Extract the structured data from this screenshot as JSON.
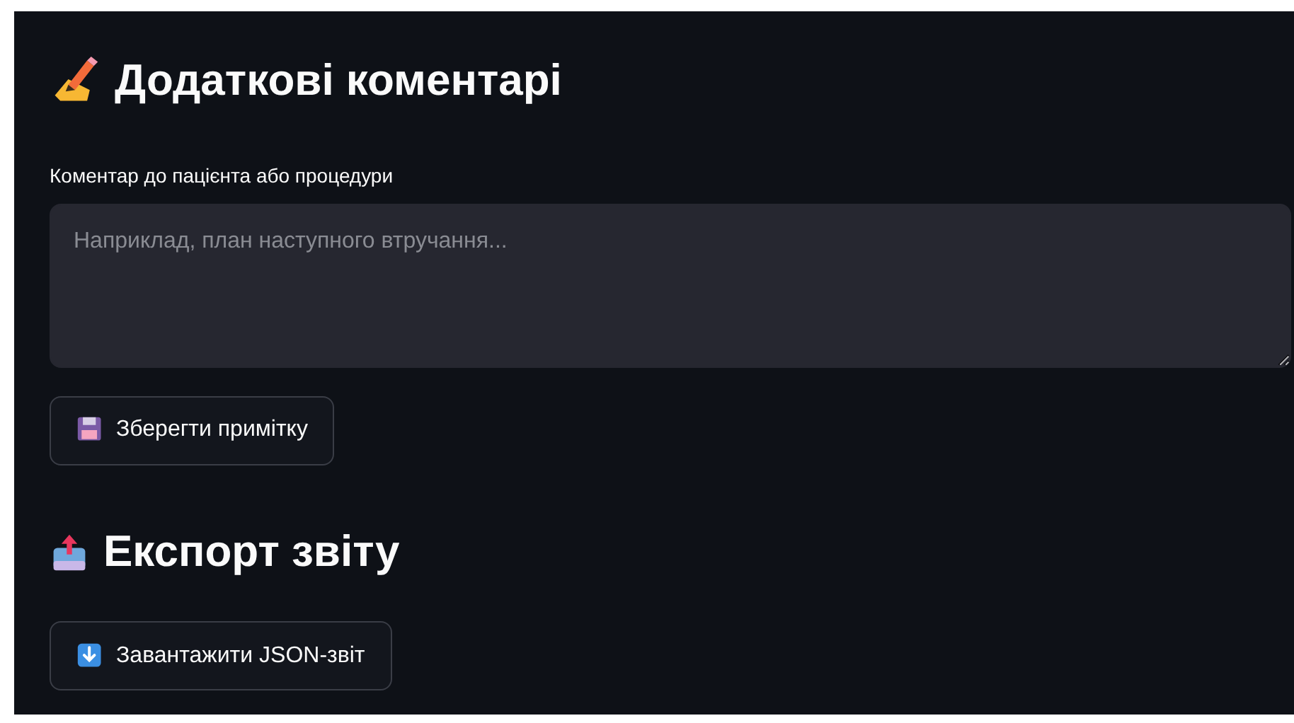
{
  "sections": [
    {
      "kind": "comments",
      "heading": "Додаткові коментарі",
      "field": {
        "label": "Коментар до пацієнта або процедури",
        "placeholder": "Наприклад, план наступного втручання..."
      },
      "button": {
        "kind": "save",
        "label": "Зберегти примітку"
      }
    },
    {
      "kind": "export",
      "heading": "Експорт звіту",
      "button": {
        "kind": "download",
        "label": "Завантажити JSON-звіт"
      }
    }
  ]
}
